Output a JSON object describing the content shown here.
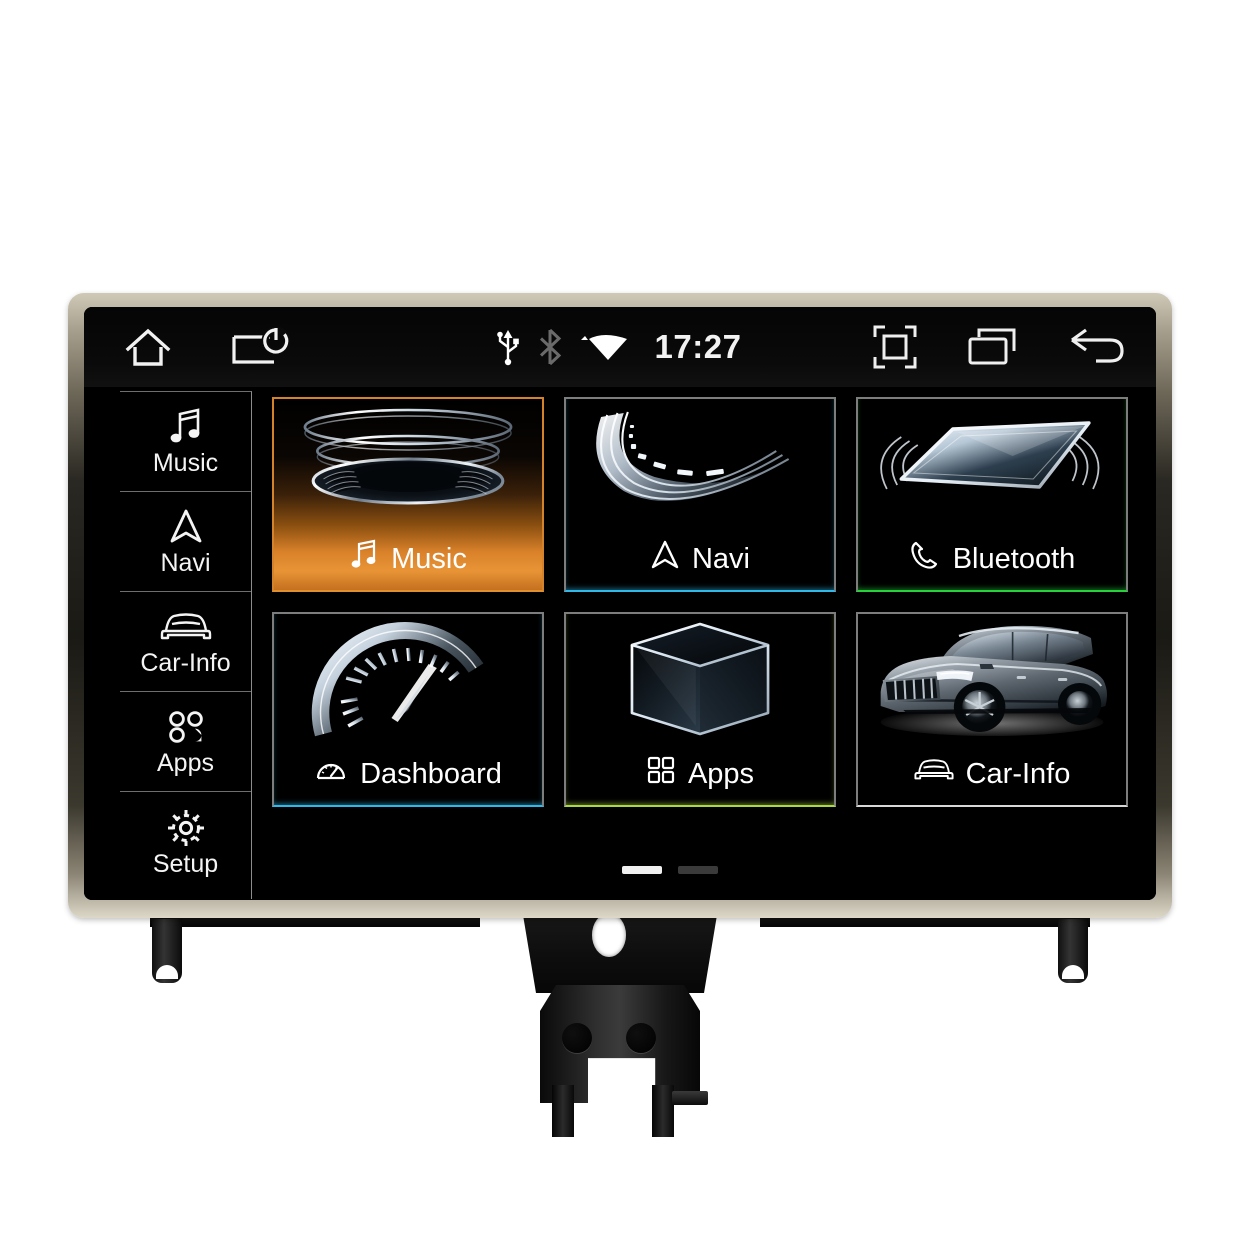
{
  "device": {
    "kind": "car-infotainment-head-unit",
    "bezel_color": "#a79f8d",
    "screen_bg": "#000000"
  },
  "status_bar": {
    "left_icons": [
      {
        "name": "home-icon",
        "glyph": "home"
      },
      {
        "name": "screen-off-icon",
        "glyph": "display-power"
      }
    ],
    "center_icons": [
      {
        "name": "usb-icon",
        "glyph": "usb",
        "state": "active",
        "color": "#ffffff"
      },
      {
        "name": "bluetooth-icon",
        "glyph": "bluetooth",
        "state": "inactive",
        "color": "#6a6a6a"
      },
      {
        "name": "wifi-icon",
        "glyph": "wifi",
        "state": "active",
        "color": "#ffffff"
      }
    ],
    "clock": "17:27",
    "right_icons": [
      {
        "name": "screenshot-icon",
        "glyph": "capture-frame"
      },
      {
        "name": "recent-apps-icon",
        "glyph": "stacked-windows"
      },
      {
        "name": "back-icon",
        "glyph": "back-arrow"
      }
    ]
  },
  "sidebar": {
    "items": [
      {
        "label": "Music",
        "icon": "music-note-icon"
      },
      {
        "label": "Navi",
        "icon": "navigation-arrow-icon"
      },
      {
        "label": "Car-Info",
        "icon": "car-front-icon"
      },
      {
        "label": "Apps",
        "icon": "apps-dots-icon"
      },
      {
        "label": "Setup",
        "icon": "gear-icon"
      }
    ]
  },
  "main": {
    "tiles": [
      {
        "label": "Music",
        "icon": "music-note-icon",
        "art": "stacked-speaker-rings",
        "active": true,
        "edge": "orange",
        "edge_color": "#e0902e"
      },
      {
        "label": "Navi",
        "icon": "navigation-arrow-icon",
        "art": "curved-road",
        "active": false,
        "edge": "cyan",
        "edge_color": "#2fb8e8"
      },
      {
        "label": "Bluetooth",
        "icon": "phone-handset-icon",
        "art": "phone-waves",
        "active": false,
        "edge": "green",
        "edge_color": "#27d13a"
      },
      {
        "label": "Dashboard",
        "icon": "speedometer-icon",
        "art": "speedometer-gauge",
        "active": false,
        "edge": "cyan",
        "edge_color": "#2fb8e8"
      },
      {
        "label": "Apps",
        "icon": "grid-squares-icon",
        "art": "wireframe-cube",
        "active": false,
        "edge": "lime",
        "edge_color": "#a8d848"
      },
      {
        "label": "Car-Info",
        "icon": "car-front-icon",
        "art": "suv-photo",
        "active": false,
        "edge": "white",
        "edge_color": "#d8d8d8"
      }
    ],
    "page_indicator": {
      "pages": 2,
      "current": 1
    }
  }
}
